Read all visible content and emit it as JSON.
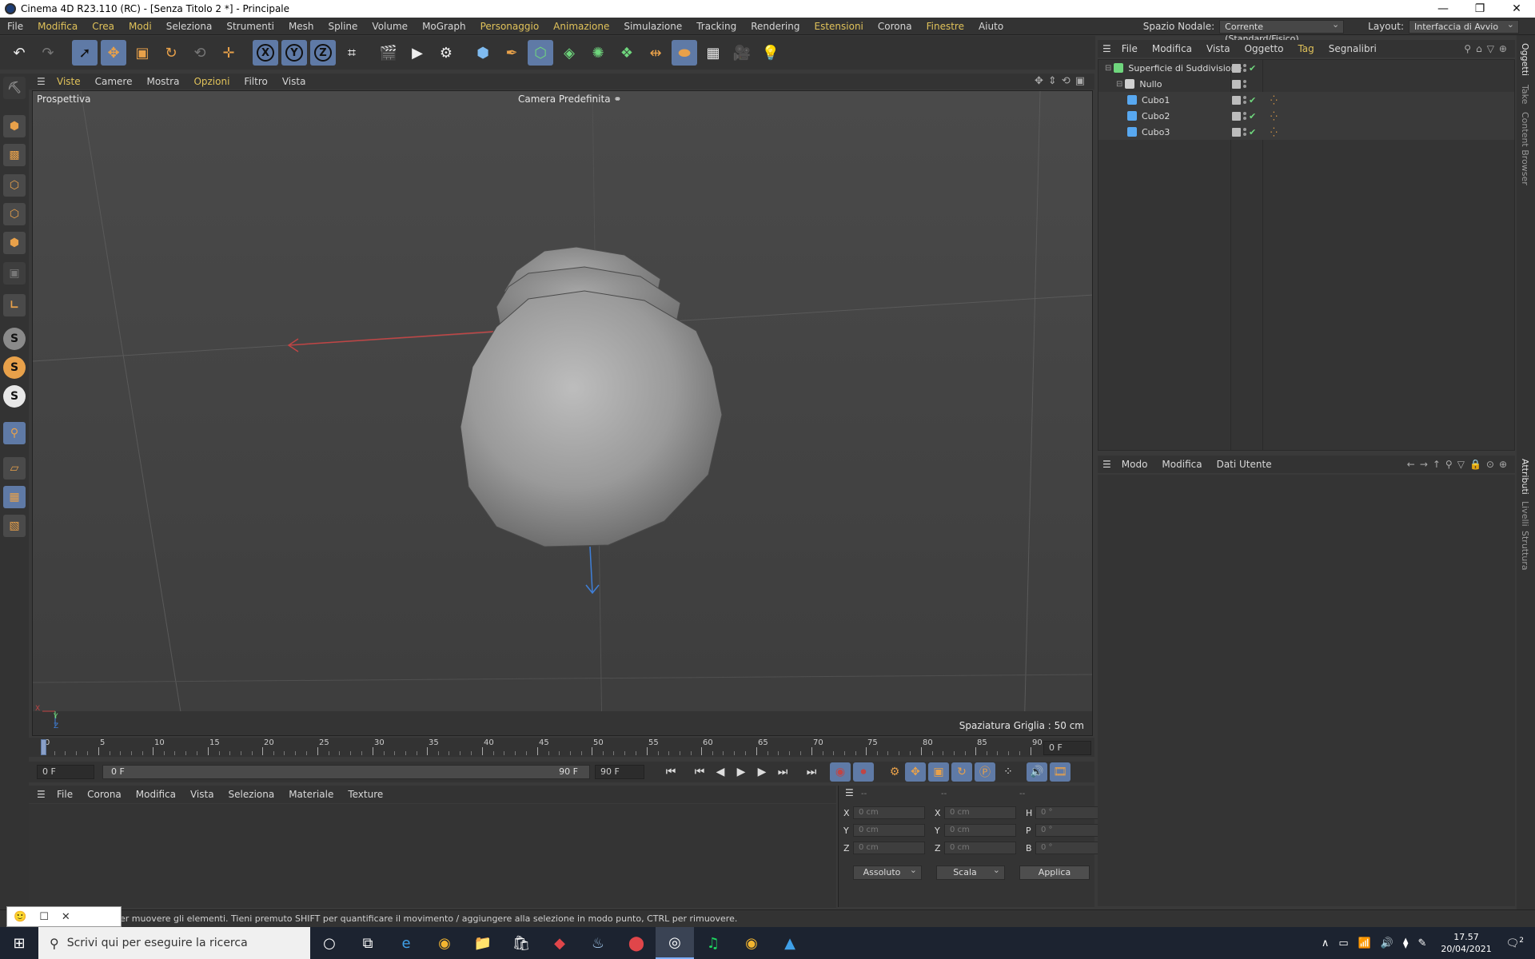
{
  "window": {
    "title": "Cinema 4D R23.110 (RC) - [Senza Titolo 2 *] - Principale",
    "controls": [
      "—",
      "❐",
      "✕"
    ]
  },
  "menubar": {
    "items": [
      {
        "label": "File",
        "hl": false
      },
      {
        "label": "Modifica",
        "hl": true
      },
      {
        "label": "Crea",
        "hl": true
      },
      {
        "label": "Modi",
        "hl": true
      },
      {
        "label": "Seleziona",
        "hl": false
      },
      {
        "label": "Strumenti",
        "hl": false
      },
      {
        "label": "Mesh",
        "hl": false
      },
      {
        "label": "Spline",
        "hl": false
      },
      {
        "label": "Volume",
        "hl": false
      },
      {
        "label": "MoGraph",
        "hl": false
      },
      {
        "label": "Personaggio",
        "hl": true
      },
      {
        "label": "Animazione",
        "hl": true
      },
      {
        "label": "Simulazione",
        "hl": false
      },
      {
        "label": "Tracking",
        "hl": false
      },
      {
        "label": "Rendering",
        "hl": false
      },
      {
        "label": "Estensioni",
        "hl": true
      },
      {
        "label": "Corona",
        "hl": false
      },
      {
        "label": "Finestre",
        "hl": true
      },
      {
        "label": "Aiuto",
        "hl": false
      }
    ],
    "node_space_label": "Spazio Nodale:",
    "node_space_value": "Corrente (Standard/Fisico)",
    "layout_label": "Layout:",
    "layout_value": "Interfaccia di Avvio"
  },
  "viewport": {
    "menu": [
      {
        "label": "Viste",
        "hl": true
      },
      {
        "label": "Camere",
        "hl": false
      },
      {
        "label": "Mostra",
        "hl": false
      },
      {
        "label": "Opzioni",
        "hl": true
      },
      {
        "label": "Filtro",
        "hl": false
      },
      {
        "label": "Vista",
        "hl": false
      }
    ],
    "view_name": "Prospettiva",
    "camera": "Camera Predefinita",
    "grid_spacing": "Spaziatura Griglia : 50 cm",
    "axis_letters": [
      "X",
      "Y",
      "Z"
    ]
  },
  "timeline": {
    "ticks": [
      "0",
      "5",
      "10",
      "15",
      "20",
      "25",
      "30",
      "35",
      "40",
      "45",
      "50",
      "55",
      "60",
      "65",
      "70",
      "75",
      "80",
      "85",
      "90"
    ],
    "current_frame": "0 F",
    "start_field": "0 F",
    "range_start": "0 F",
    "range_end": "90 F",
    "end_field": "90 F"
  },
  "materials": {
    "menu": [
      "File",
      "Corona",
      "Modifica",
      "Vista",
      "Seleziona",
      "Materiale",
      "Texture"
    ]
  },
  "coords": {
    "headers": [
      "--",
      "--",
      "--"
    ],
    "rows": [
      {
        "l1": "X",
        "v1": "0 cm",
        "l2": "X",
        "v2": "0 cm",
        "l3": "H",
        "v3": "0 °"
      },
      {
        "l1": "Y",
        "v1": "0 cm",
        "l2": "Y",
        "v2": "0 cm",
        "l3": "P",
        "v3": "0 °"
      },
      {
        "l1": "Z",
        "v1": "0 cm",
        "l2": "Z",
        "v2": "0 cm",
        "l3": "B",
        "v3": "0 °"
      }
    ],
    "mode_value": "Assoluto",
    "scale_value": "Scala",
    "apply_label": "Applica"
  },
  "objects": {
    "menu": [
      {
        "label": "File",
        "hl": false
      },
      {
        "label": "Modifica",
        "hl": false
      },
      {
        "label": "Vista",
        "hl": false
      },
      {
        "label": "Oggetto",
        "hl": false
      },
      {
        "label": "Tag",
        "hl": true
      },
      {
        "label": "Segnalibri",
        "hl": false
      }
    ],
    "items": [
      {
        "name": "Superficie di Suddivisione",
        "indent": 0,
        "color": "#6fd67d",
        "check": true,
        "tag": false
      },
      {
        "name": "Nullo",
        "indent": 1,
        "color": "#cfcfcf",
        "check": false,
        "tag": false
      },
      {
        "name": "Cubo1",
        "indent": 2,
        "color": "#58a8f0",
        "check": true,
        "tag": true
      },
      {
        "name": "Cubo2",
        "indent": 2,
        "color": "#58a8f0",
        "check": true,
        "tag": true
      },
      {
        "name": "Cubo3",
        "indent": 2,
        "color": "#58a8f0",
        "check": true,
        "tag": true
      }
    ]
  },
  "attributes": {
    "menu": [
      "Modo",
      "Modifica",
      "Dati Utente"
    ]
  },
  "right_tabs": {
    "top": [
      "Oggetti",
      "Take",
      "Content Browser"
    ],
    "bottom": [
      "Attributi",
      "Livelli",
      "Struttura"
    ]
  },
  "status": {
    "text": "er muovere gli elementi. Tieni premuto SHIFT per quantificare il movimento / aggiungere alla selezione in modo punto, CTRL per rimuovere."
  },
  "taskbar": {
    "search_placeholder": "Scrivi qui per eseguire la ricerca",
    "time": "17.57",
    "date": "20/04/2021",
    "notification_count": "2"
  },
  "colors": {
    "accent_yellow": "#e0c25a",
    "tool_orange": "#e8a14a",
    "selection_blue": "#5f7aa6"
  }
}
